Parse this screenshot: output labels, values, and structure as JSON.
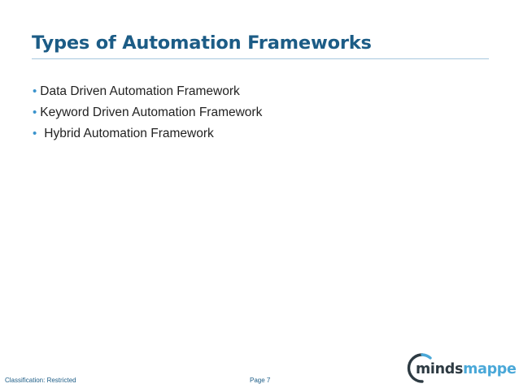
{
  "slide": {
    "title": "Types of Automation Frameworks",
    "bullets": [
      {
        "text": "Data Driven Automation Framework"
      },
      {
        "text": "Keyword Driven Automation Framework"
      },
      {
        "text": "Hybrid Automation Framework"
      }
    ],
    "bullet_glyph": "•"
  },
  "footer": {
    "classification": "Classification: Restricted",
    "page": "Page 7"
  },
  "logo": {
    "text_part1": "minds",
    "text_part2": "mapped"
  },
  "colors": {
    "title": "#1c5c86",
    "bullet": "#3a93cc",
    "rule": "#a7c7de",
    "logo_dark": "#2d3a42",
    "logo_accent": "#4aa8d8"
  }
}
